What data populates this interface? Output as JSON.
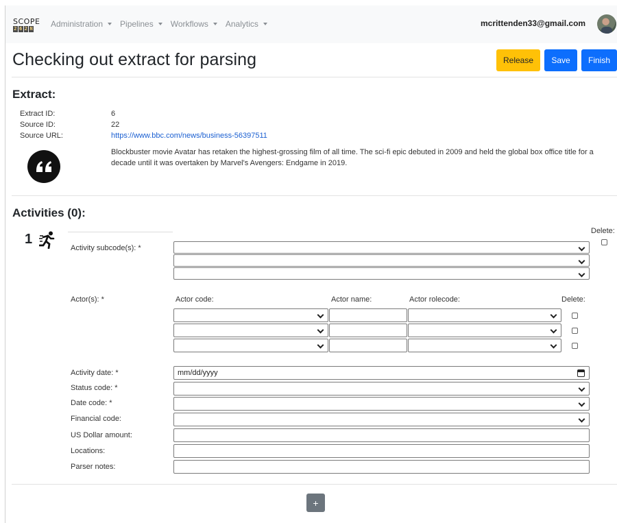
{
  "app": {
    "logo_top": "SCOPE",
    "logo_bottom": [
      "2",
      "6",
      "2",
      "N"
    ]
  },
  "nav": {
    "items": [
      {
        "label": "Administration"
      },
      {
        "label": "Pipelines"
      },
      {
        "label": "Workflows"
      },
      {
        "label": "Analytics"
      }
    ],
    "user_email": "mcrittenden33@gmail.com"
  },
  "header": {
    "title": "Checking out extract for parsing",
    "release_label": "Release",
    "save_label": "Save",
    "finish_label": "Finish"
  },
  "extract": {
    "heading": "Extract:",
    "extract_id_label": "Extract ID:",
    "extract_id": "6",
    "source_id_label": "Source ID:",
    "source_id": "22",
    "source_url_label": "Source URL:",
    "source_url": "https://www.bbc.com/news/business-56397511",
    "text": "Blockbuster movie Avatar has retaken the highest-grossing film of all time. The sci-fi epic debuted in 2009 and held the global box office title for a decade until it was overtaken by Marvel's Avengers: Endgame in 2019."
  },
  "activities": {
    "heading": "Activities (0):",
    "activity_number": "1",
    "delete_label": "Delete:",
    "labels": {
      "subcodes": "Activity subcode(s): *",
      "actors": "Actor(s): *",
      "actor_code": "Actor code:",
      "actor_name": "Actor name:",
      "actor_rolecode": "Actor rolecode:",
      "actor_delete": "Delete:",
      "date": "Activity date: *",
      "status": "Status code: *",
      "date_code": "Date code: *",
      "financial": "Financial code:",
      "usd": "US Dollar amount:",
      "locations": "Locations:",
      "notes": "Parser notes:"
    },
    "date_placeholder": "mm/dd/yyyy",
    "add_label": "+"
  },
  "colors": {
    "release": "#ffc107",
    "primary": "#0d6efd",
    "secondary": "#6c757d",
    "link": "#1a5fd1"
  }
}
